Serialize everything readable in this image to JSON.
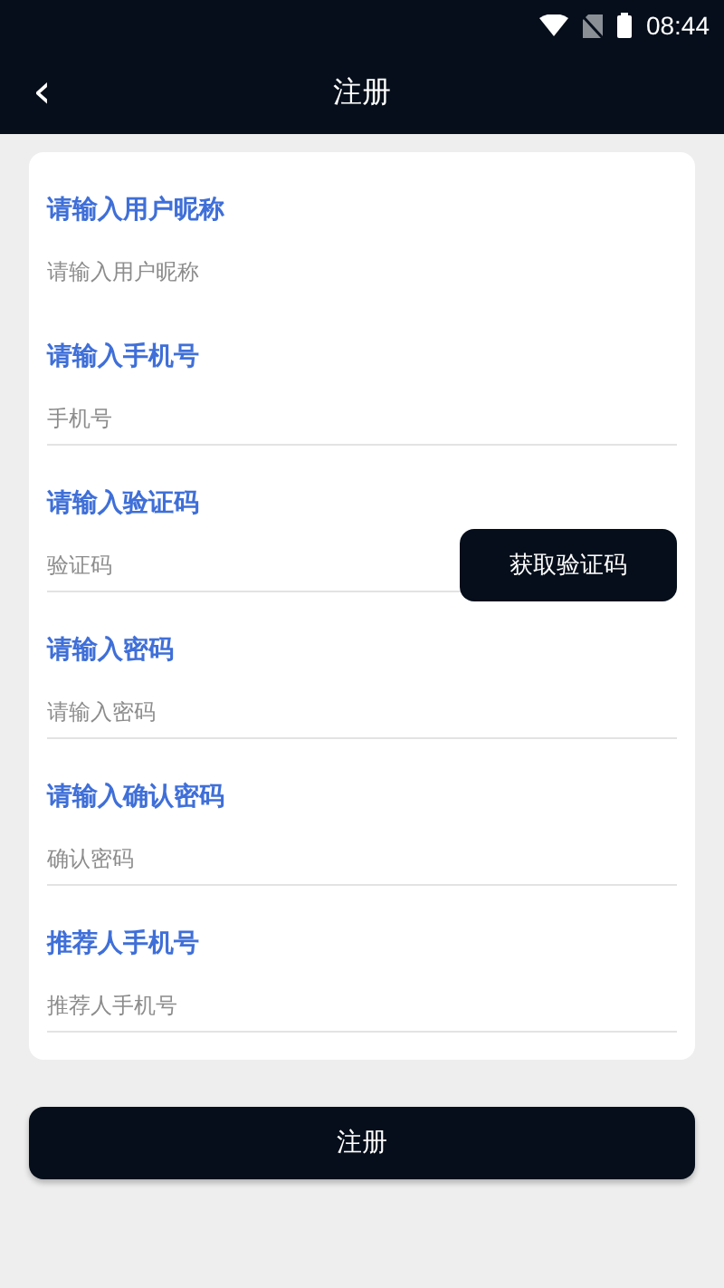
{
  "status_bar": {
    "time": "08:44"
  },
  "header": {
    "back": "‹",
    "title": "注册"
  },
  "fields": [
    {
      "kind": "plain",
      "label": "请输入用户昵称",
      "placeholder": "请输入用户昵称",
      "divider": false
    },
    {
      "kind": "plain",
      "label": "请输入手机号",
      "placeholder": "手机号",
      "divider": true
    },
    {
      "kind": "code",
      "label": "请输入验证码",
      "placeholder": "验证码",
      "button": "获取验证码",
      "divider": true
    },
    {
      "kind": "plain",
      "label": "请输入密码",
      "placeholder": "请输入密码",
      "divider": true
    },
    {
      "kind": "plain",
      "label": "请输入确认密码",
      "placeholder": "确认密码",
      "divider": true
    },
    {
      "kind": "plain",
      "label": "推荐人手机号",
      "placeholder": "推荐人手机号",
      "divider": true
    }
  ],
  "submit": "注册"
}
